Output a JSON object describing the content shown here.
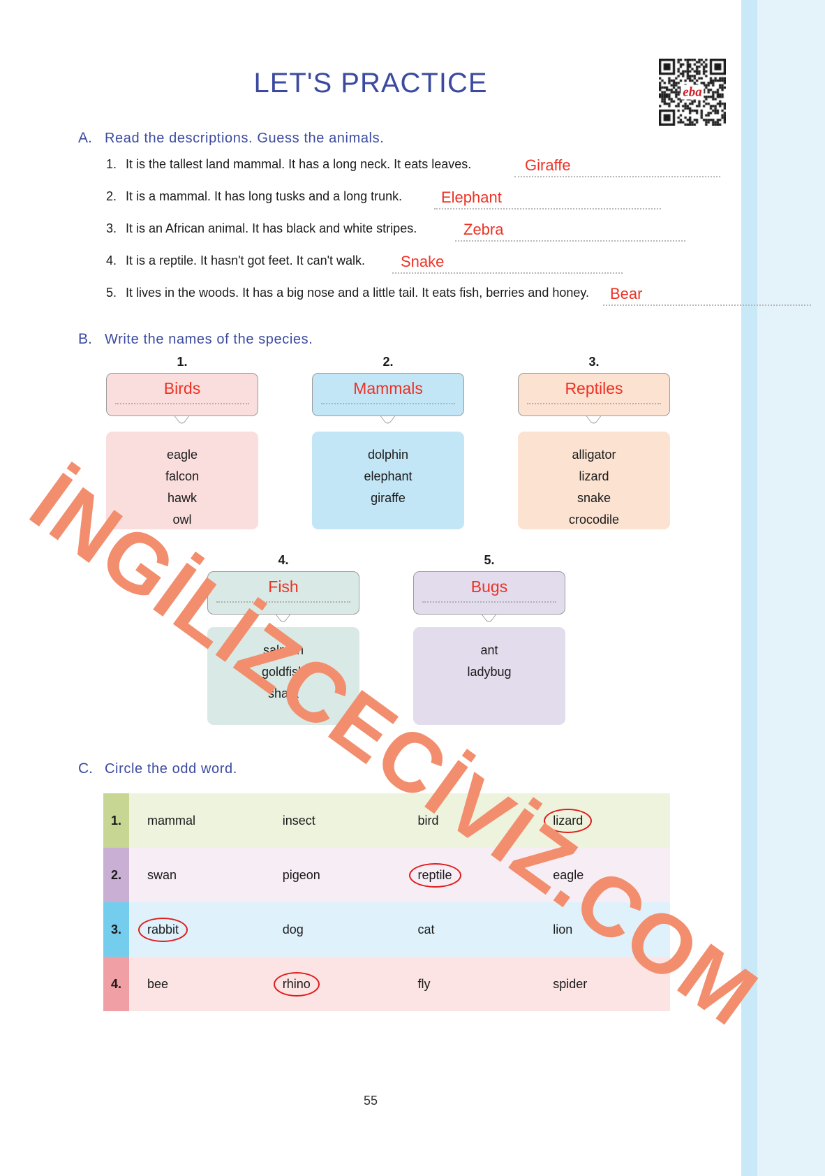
{
  "page": {
    "title": "LET'S PRACTICE",
    "page_number": "55",
    "watermark": "İNGİLİZCECİVİZ.COM",
    "qr_logo": "eba",
    "colors": {
      "heading_blue": "#3b4aa0",
      "answer_red": "#ee3124",
      "circle_red": "#e01b1b",
      "watermark_orange": "#f28e6e",
      "edge_blue_thin": "#c9e9f8",
      "edge_blue_wide": "#e4f3fa"
    }
  },
  "section_a": {
    "letter": "A.",
    "title": "Read the descriptions. Guess the animals.",
    "questions": [
      {
        "num": "1.",
        "text": "It is the tallest land mammal. It has a long neck. It eats leaves.",
        "answer": "Giraffe"
      },
      {
        "num": "2.",
        "text": "It is a mammal. It has long tusks and a long trunk.",
        "answer": "Elephant"
      },
      {
        "num": "3.",
        "text": "It is an African animal. It has black and white stripes.",
        "answer": "Zebra"
      },
      {
        "num": "4.",
        "text": "It is a reptile. It hasn't got feet. It can't walk.",
        "answer": "Snake"
      },
      {
        "num": "5.",
        "text": "It lives in the woods. It has a big nose and a little tail. It eats fish, berries and honey.",
        "answer": "Bear"
      }
    ]
  },
  "section_b": {
    "letter": "B.",
    "title": "Write the names of the species.",
    "groups": [
      {
        "num": "1.",
        "category": "Birds",
        "words": [
          "eagle",
          "falcon",
          "hawk",
          "owl"
        ],
        "label_bg": "#fadede",
        "content_bg": "#fadede"
      },
      {
        "num": "2.",
        "category": "Mammals",
        "words": [
          "dolphin",
          "elephant",
          "giraffe"
        ],
        "label_bg": "#c3e6f7",
        "content_bg": "#c3e6f7"
      },
      {
        "num": "3.",
        "category": "Reptiles",
        "words": [
          "alligator",
          "lizard",
          "snake",
          "crocodile"
        ],
        "label_bg": "#fbe2d1",
        "content_bg": "#fbe2d1"
      },
      {
        "num": "4.",
        "category": "Fish",
        "words": [
          "salmon",
          "goldfish",
          "shark"
        ],
        "label_bg": "#d9e9e5",
        "content_bg": "#d9e9e5"
      },
      {
        "num": "5.",
        "category": "Bugs",
        "words": [
          "ant",
          "ladybug"
        ],
        "label_bg": "#e3dced",
        "content_bg": "#e3dced"
      }
    ]
  },
  "section_c": {
    "letter": "C.",
    "title": "Circle the odd word.",
    "rows": [
      {
        "num": "1.",
        "tab_color": "#c7d693",
        "row_color": "#eef3dd",
        "words": [
          "mammal",
          "insect",
          "bird",
          "lizard"
        ],
        "circled_index": 3
      },
      {
        "num": "2.",
        "tab_color": "#c9afd4",
        "row_color": "#f7eef5",
        "words": [
          "swan",
          "pigeon",
          "reptile",
          "eagle"
        ],
        "circled_index": 2
      },
      {
        "num": "3.",
        "tab_color": "#74cdec",
        "row_color": "#dff2fb",
        "words": [
          "rabbit",
          "dog",
          "cat",
          "lion"
        ],
        "circled_index": 0
      },
      {
        "num": "4.",
        "tab_color": "#f0a0a4",
        "row_color": "#fbe4e3",
        "words": [
          "bee",
          "rhino",
          "fly",
          "spider"
        ],
        "circled_index": 1
      }
    ]
  }
}
